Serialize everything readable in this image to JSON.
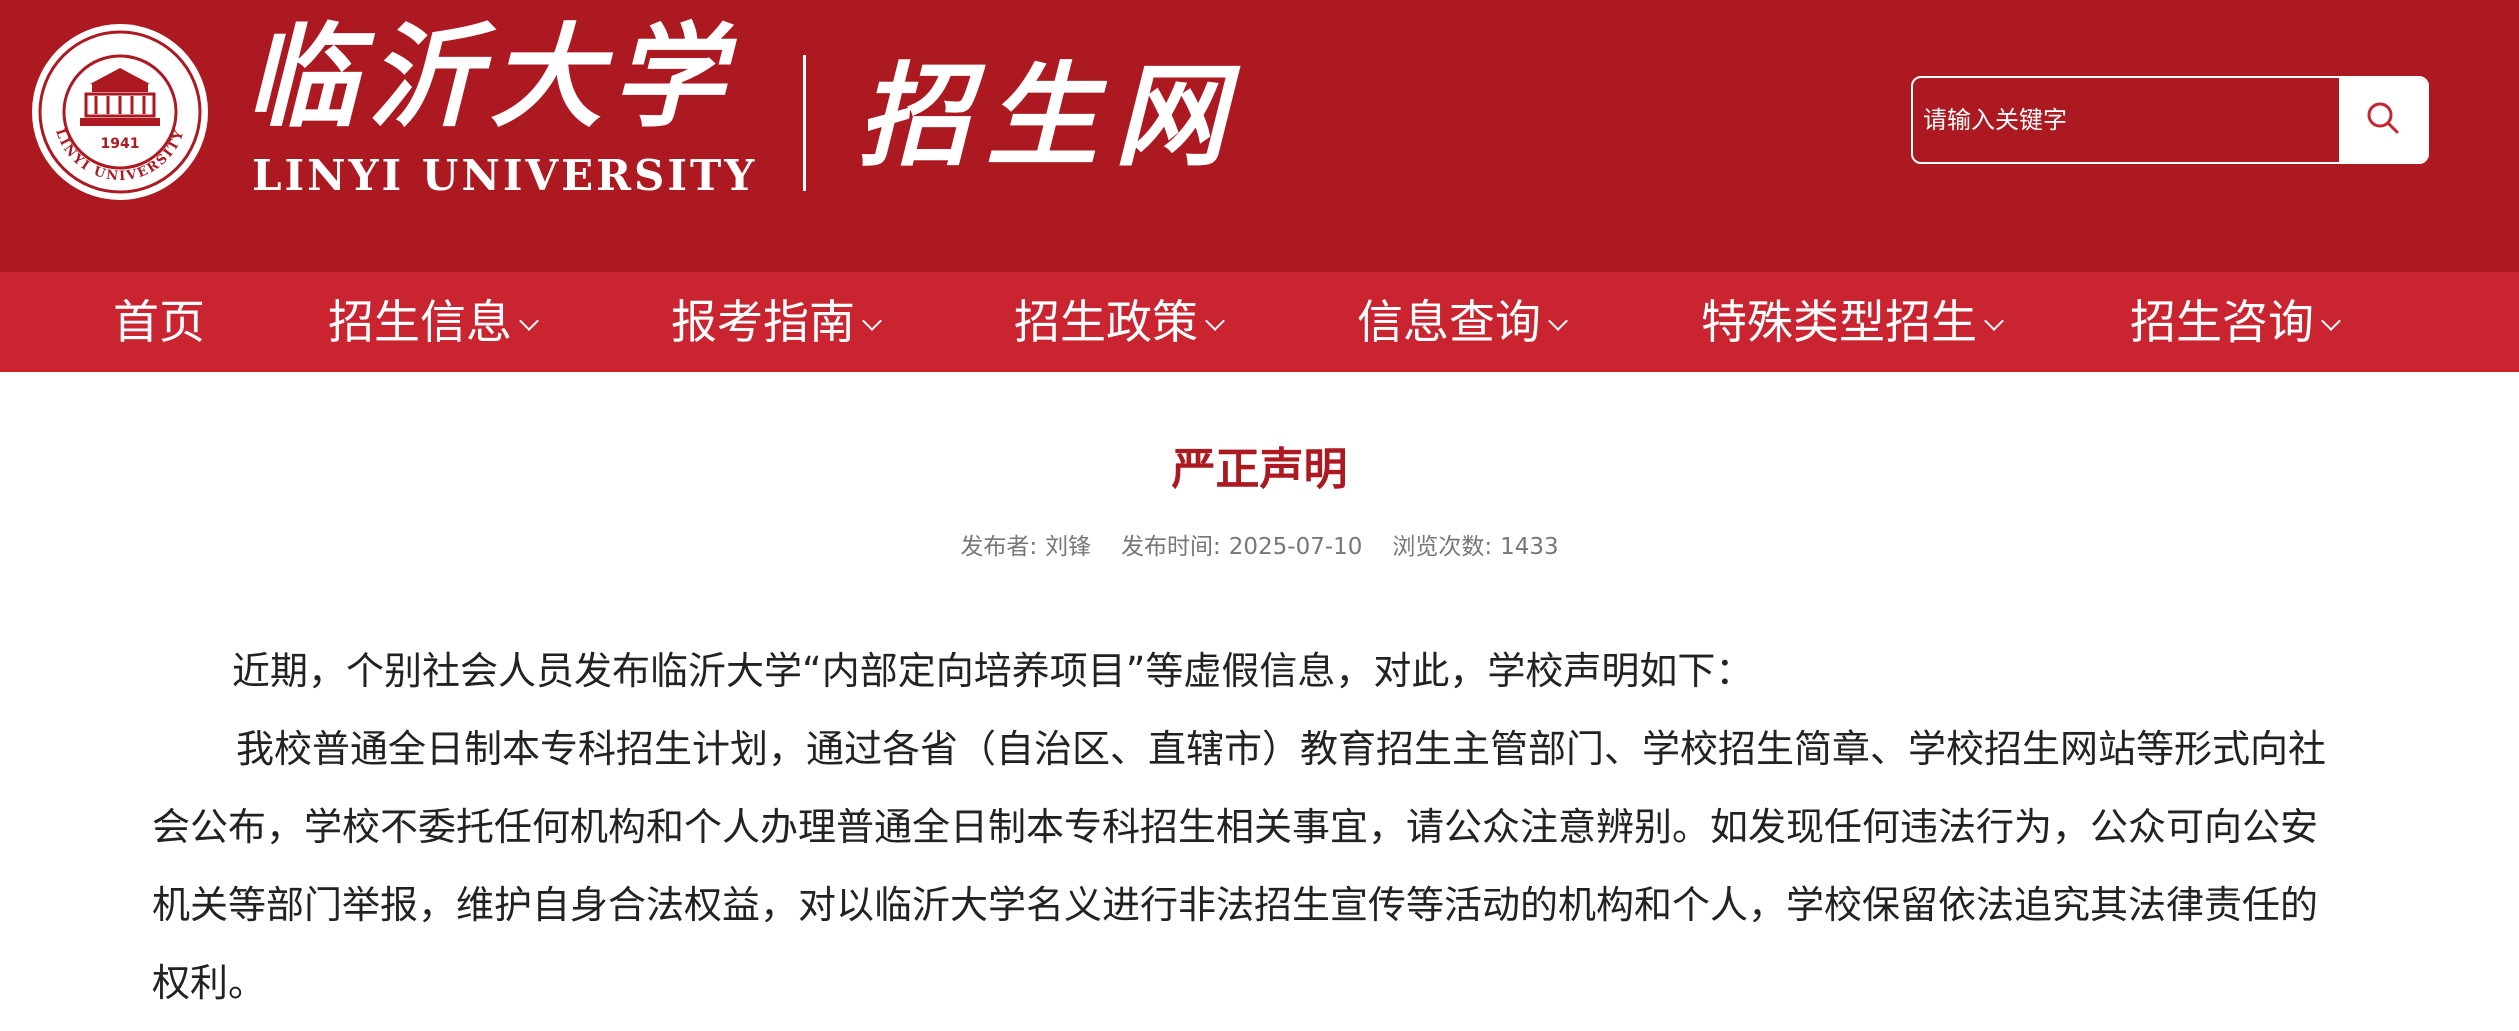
{
  "header": {
    "school_name_cn": "临沂大学",
    "school_name_en": "LINYI UNIVERSITY",
    "site_name": "招生网",
    "seal_year": "1941",
    "seal_text": "LINYI UNIVERSITY",
    "brand_color": "#ac1920"
  },
  "search": {
    "placeholder": "请输入关键字",
    "icon": "search-icon"
  },
  "nav": {
    "items": [
      {
        "label": "首页",
        "has_dropdown": false
      },
      {
        "label": "招生信息",
        "has_dropdown": true
      },
      {
        "label": "报考指南",
        "has_dropdown": true
      },
      {
        "label": "招生政策",
        "has_dropdown": true
      },
      {
        "label": "信息查询",
        "has_dropdown": true
      },
      {
        "label": "特殊类型招生",
        "has_dropdown": true
      },
      {
        "label": "招生咨询",
        "has_dropdown": true
      }
    ],
    "bg_color": "#c9242f"
  },
  "article": {
    "title": "严正声明",
    "publisher_label": "发布者:",
    "publisher": "刘锋",
    "date_label": "发布时间:",
    "date": "2025-07-10",
    "views_label": "浏览次数:",
    "views": "1433",
    "paragraphs": [
      "近期，个别社会人员发布临沂大学“内部定向培养项目”等虚假信息，对此，学校声明如下：",
      "我校普通全日制本专科招生计划，通过各省（自治区、直辖市）教育招生主管部门、学校招生简章、学校招生网站等形式向社会公布，学校不委托任何机构和个人办理普通全日制本专科招生相关事宜，请公众注意辨别。如发现任何违法行为，公众可向公安机关等部门举报，维护自身合法权益，对以临沂大学名义进行非法招生宣传等活动的机构和个人，学校保留依法追究其法律责任的权利。"
    ]
  }
}
